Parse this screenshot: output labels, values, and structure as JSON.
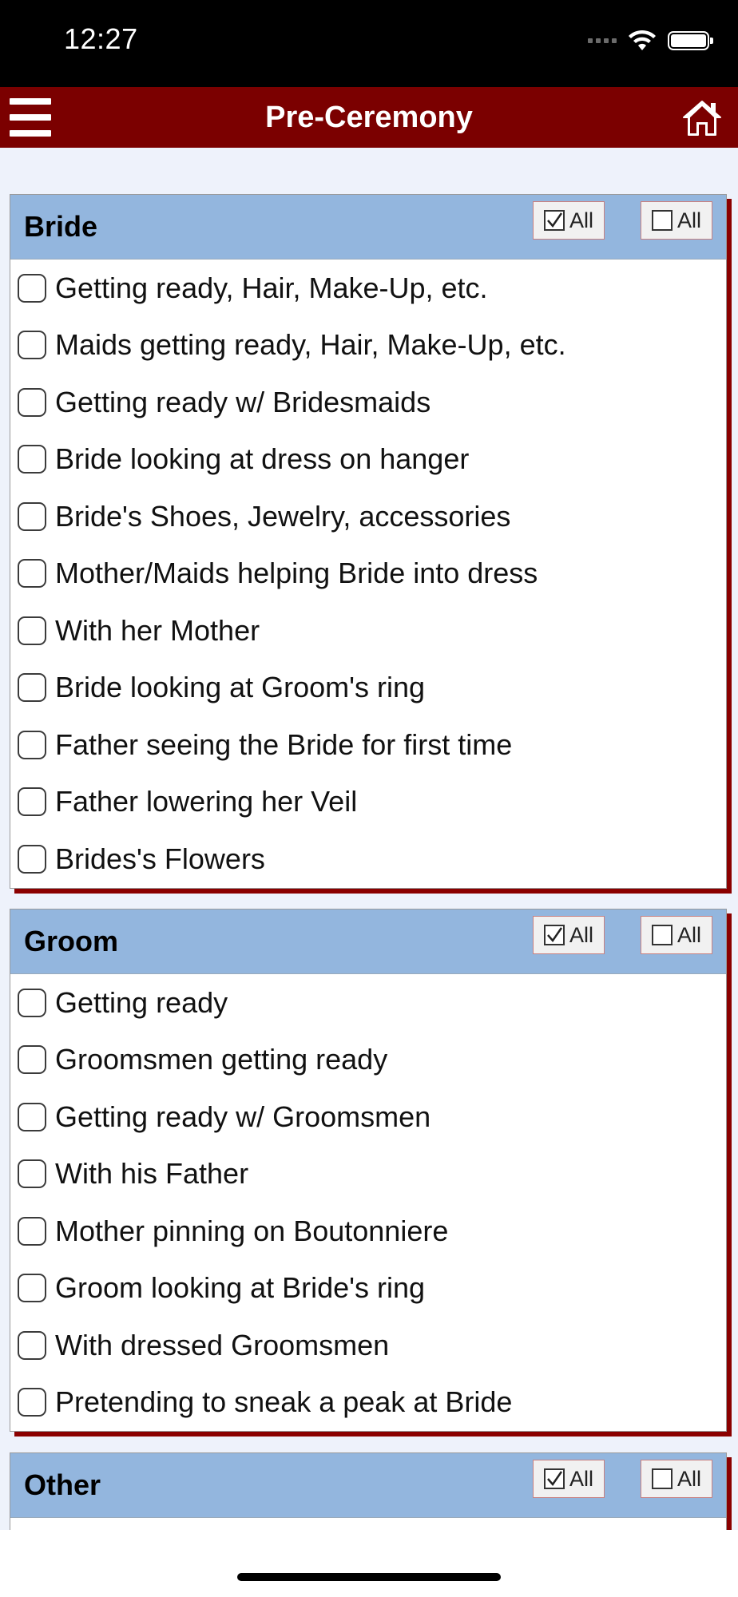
{
  "status": {
    "time": "12:27"
  },
  "nav": {
    "title": "Pre-Ceremony"
  },
  "colors": {
    "nav_bg": "#7b0000",
    "header_bg": "#93b6de",
    "shadow": "#8b0000",
    "page_bg": "#eef2fb"
  },
  "sections": [
    {
      "title": "Bride",
      "check_all_label": "All",
      "uncheck_all_label": "All",
      "items": [
        "Getting ready, Hair, Make-Up, etc.",
        "Maids getting ready, Hair, Make-Up, etc.",
        "Getting ready w/ Bridesmaids",
        "Bride looking at dress on hanger",
        "Bride's Shoes, Jewelry, accessories",
        "Mother/Maids helping Bride into dress",
        "With her Mother",
        "Bride looking at Groom's ring",
        "Father seeing the Bride for first time",
        "Father lowering her Veil",
        "Brides's Flowers"
      ]
    },
    {
      "title": "Groom",
      "check_all_label": "All",
      "uncheck_all_label": "All",
      "items": [
        "Getting ready",
        "Groomsmen getting ready",
        "Getting ready w/ Groomsmen",
        "With his Father",
        "Mother pinning on Boutonniere",
        "Groom looking at Bride's ring",
        "With dressed Groomsmen",
        "Pretending to sneak a peak at Bride"
      ]
    },
    {
      "title": "Other",
      "check_all_label": "All",
      "uncheck_all_label": "All",
      "items": []
    }
  ]
}
